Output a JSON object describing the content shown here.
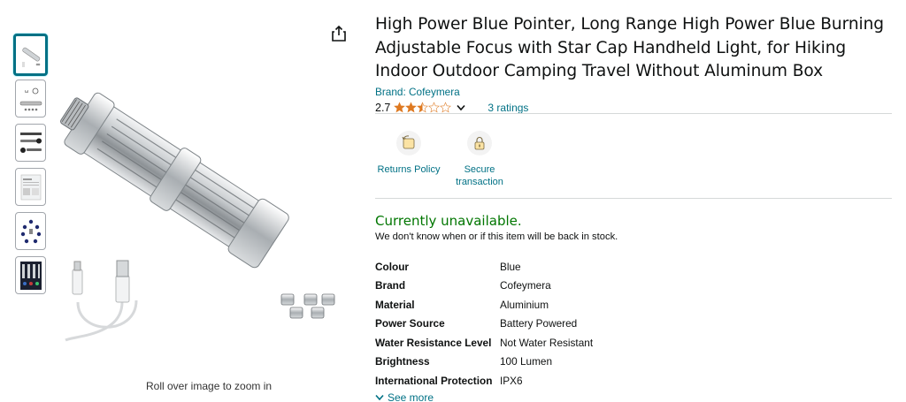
{
  "product": {
    "title": "High Power Blue Pointer, Long Range High Power Blue Burning Adjustable Focus with Star Cap Handheld Light, for Hiking Indoor Outdoor Camping Travel Without Aluminum Box",
    "brand_link": "Brand: Cofeymera",
    "rating_value": "2.7",
    "rating": 2.7,
    "rating_max": 5,
    "ratings_count_label": "3 ratings"
  },
  "gallery": {
    "zoom_hint": "Roll over image to zoom in",
    "thumbnail_count": 6,
    "selected_index": 0
  },
  "badges": [
    {
      "label_line1": "Returns Policy",
      "label_line2": "",
      "icon": "returns-icon"
    },
    {
      "label_line1": "Secure",
      "label_line2": "transaction",
      "icon": "lock-icon"
    }
  ],
  "availability": {
    "title": "Currently unavailable.",
    "subtitle": "We don't know when or if this item will be back in stock."
  },
  "specs": [
    {
      "key": "Colour",
      "value": "Blue"
    },
    {
      "key": "Brand",
      "value": "Cofeymera"
    },
    {
      "key": "Material",
      "value": "Aluminium"
    },
    {
      "key": "Power Source",
      "value": "Battery Powered"
    },
    {
      "key": "Water Resistance Level",
      "value": "Not Water Resistant"
    },
    {
      "key": "Brightness",
      "value": "100 Lumen"
    },
    {
      "key": "International Protection",
      "value": "IPX6"
    }
  ],
  "see_more": "See more",
  "colors": {
    "link": "#007185",
    "available_green": "#007600",
    "star": "#de7921",
    "selected_thumb_border": "#007185"
  }
}
